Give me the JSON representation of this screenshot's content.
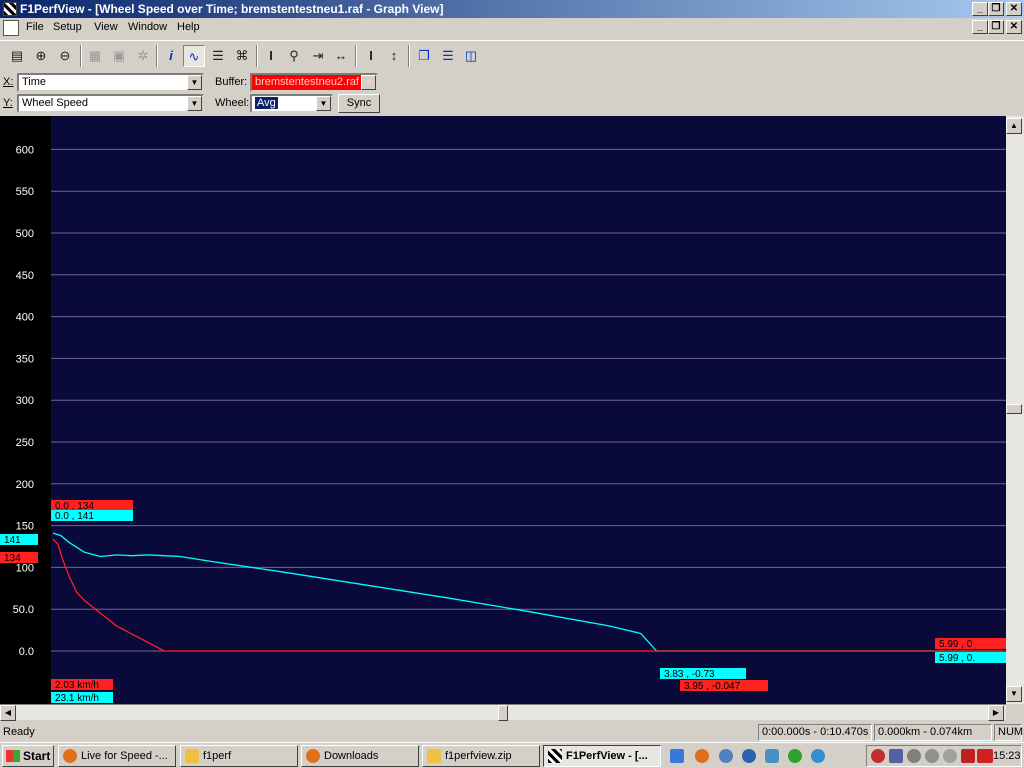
{
  "window": {
    "title": "F1PerfView - [Wheel Speed over Time; bremstentestneu1.raf - Graph View]",
    "min": "_",
    "max": "❐",
    "close": "✕"
  },
  "menu": [
    "File",
    "Setup",
    "View",
    "Window",
    "Help"
  ],
  "controls": {
    "x_label": "X:",
    "x_value": "Time",
    "y_label": "Y:",
    "y_value": "Wheel Speed",
    "buffer_label": "Buffer:",
    "buffer_value": "bremstentestneu2.raf",
    "wheel_label": "Wheel:",
    "wheel_value": "Avg",
    "sync_label": "Sync"
  },
  "graph": {
    "background": "#0a0a3a",
    "left_markers": {
      "cyan": "141",
      "red": "134"
    },
    "top_markers": {
      "red": "0.0 ,     134",
      "cyan": "0.0 ,     141"
    },
    "bottom_markers": {
      "red": "2.03  km/h",
      "cyan": "23.1  km/h"
    },
    "mid_markers": {
      "cyan": "3.83 ,   -0.73",
      "red": "3.95 ,  -0.047"
    },
    "right_markers": {
      "red": "5.99 ,     0",
      "cyan": "5.99 ,     0."
    }
  },
  "chart_data": {
    "type": "line",
    "title": "",
    "xlabel": "Time",
    "ylabel": "Wheel Speed",
    "ylim": [
      -20,
      650
    ],
    "xlim": [
      0,
      6.0
    ],
    "yticks": [
      "600",
      "550",
      "500",
      "450",
      "400",
      "350",
      "300",
      "250",
      "200",
      "150",
      "100",
      "50.0",
      "0.0"
    ],
    "grid": true,
    "series": [
      {
        "name": "bremstentestneu1.raf",
        "color": "#00ffff",
        "x": [
          0,
          0.05,
          0.1,
          0.2,
          0.3,
          0.4,
          0.5,
          0.6,
          0.7,
          0.8,
          1.0,
          1.5,
          2.0,
          2.5,
          3.0,
          3.5,
          3.7,
          3.8,
          3.83,
          4.0,
          5.0,
          5.99
        ],
        "y": [
          141,
          138,
          130,
          118,
          113,
          115,
          114,
          115,
          114,
          113,
          107,
          93,
          78,
          63,
          47,
          30,
          21,
          0,
          0,
          0,
          0,
          0
        ]
      },
      {
        "name": "bremstentestneu2.raf",
        "color": "#ff2020",
        "x": [
          0,
          0.03,
          0.06,
          0.1,
          0.15,
          0.2,
          0.3,
          0.4,
          0.5,
          0.6,
          0.7,
          1.0,
          2.0,
          3.0,
          4.0,
          5.0,
          5.99
        ],
        "y": [
          134,
          128,
          110,
          90,
          70,
          60,
          45,
          30,
          20,
          10,
          0,
          0,
          0,
          0,
          0,
          0,
          0
        ]
      }
    ]
  },
  "status": {
    "ready": "Ready",
    "time_range": "0:00.000s - 0:10.470s",
    "dist_range": "0.000km - 0.074km",
    "num": "NUM"
  },
  "taskbar": {
    "start": "Start",
    "tasks": [
      "Live for Speed -...",
      "f1perf",
      "Downloads",
      "f1perfview.zip",
      "F1PerfView - [..."
    ],
    "clock": "15:23"
  }
}
